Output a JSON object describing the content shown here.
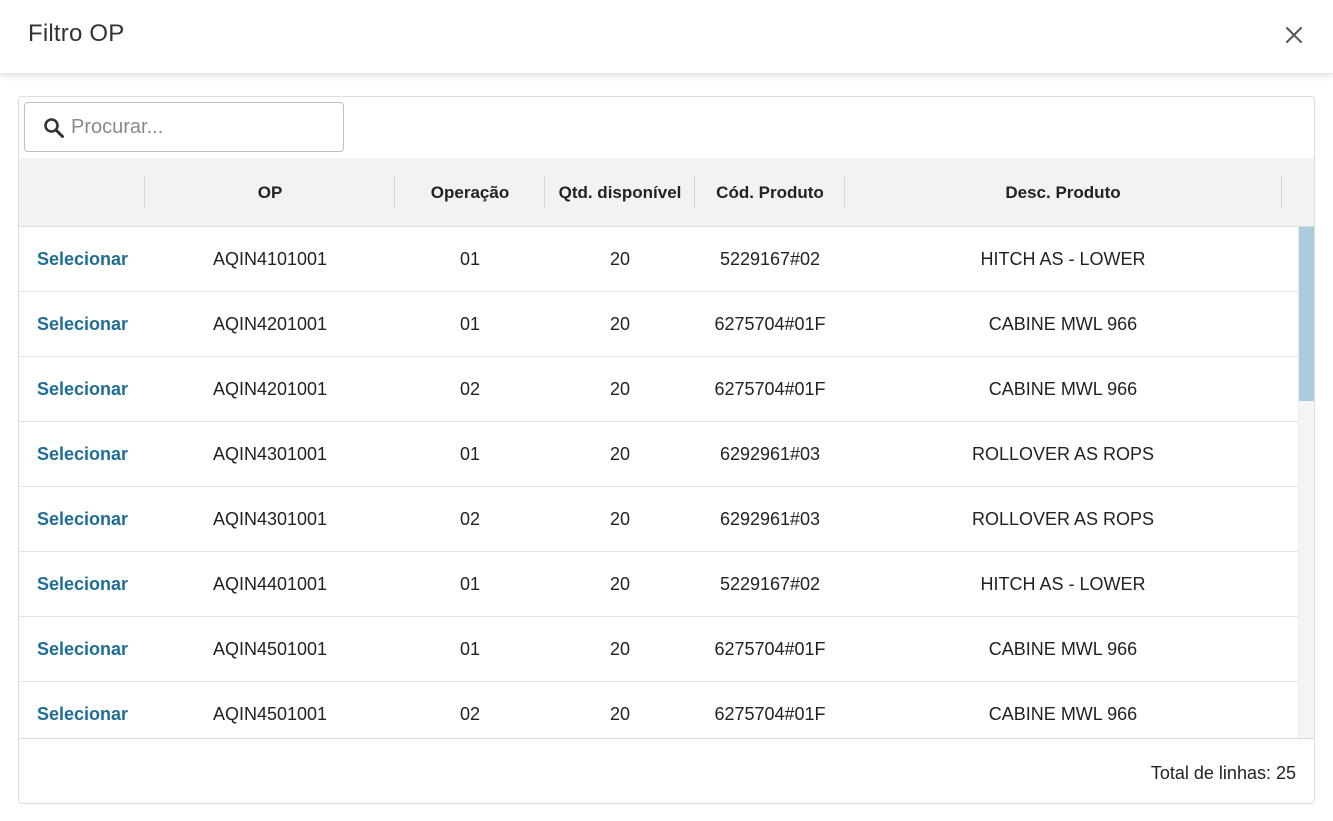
{
  "dialog": {
    "title": "Filtro OP"
  },
  "search": {
    "placeholder": "Procurar..."
  },
  "columns": [
    {
      "label": ""
    },
    {
      "label": "OP"
    },
    {
      "label": "Operação"
    },
    {
      "label": "Qtd. disponível"
    },
    {
      "label": "Cód. Produto"
    },
    {
      "label": "Desc. Produto"
    }
  ],
  "rows": [
    {
      "action": "Selecionar",
      "op": "AQIN4101001",
      "operacao": "01",
      "qtd": "20",
      "cod": "5229167#02",
      "desc": "HITCH AS - LOWER"
    },
    {
      "action": "Selecionar",
      "op": "AQIN4201001",
      "operacao": "01",
      "qtd": "20",
      "cod": "6275704#01F",
      "desc": "CABINE MWL 966"
    },
    {
      "action": "Selecionar",
      "op": "AQIN4201001",
      "operacao": "02",
      "qtd": "20",
      "cod": "6275704#01F",
      "desc": "CABINE MWL 966"
    },
    {
      "action": "Selecionar",
      "op": "AQIN4301001",
      "operacao": "01",
      "qtd": "20",
      "cod": "6292961#03",
      "desc": "ROLLOVER AS ROPS"
    },
    {
      "action": "Selecionar",
      "op": "AQIN4301001",
      "operacao": "02",
      "qtd": "20",
      "cod": "6292961#03",
      "desc": "ROLLOVER AS ROPS"
    },
    {
      "action": "Selecionar",
      "op": "AQIN4401001",
      "operacao": "01",
      "qtd": "20",
      "cod": "5229167#02",
      "desc": "HITCH AS - LOWER"
    },
    {
      "action": "Selecionar",
      "op": "AQIN4501001",
      "operacao": "01",
      "qtd": "20",
      "cod": "6275704#01F",
      "desc": "CABINE MWL 966"
    },
    {
      "action": "Selecionar",
      "op": "AQIN4501001",
      "operacao": "02",
      "qtd": "20",
      "cod": "6275704#01F",
      "desc": "CABINE MWL 966"
    }
  ],
  "footer": {
    "total_lines": "Total de linhas: 25"
  },
  "scroll": {
    "visible_fraction": 0.34,
    "position_fraction": 0.0
  },
  "colors": {
    "link": "#1f6d96",
    "scroll_thumb": "#a9cbdd",
    "header_bg": "#f2f2f2"
  },
  "icons": {
    "close": "close-icon",
    "search": "search-icon"
  }
}
